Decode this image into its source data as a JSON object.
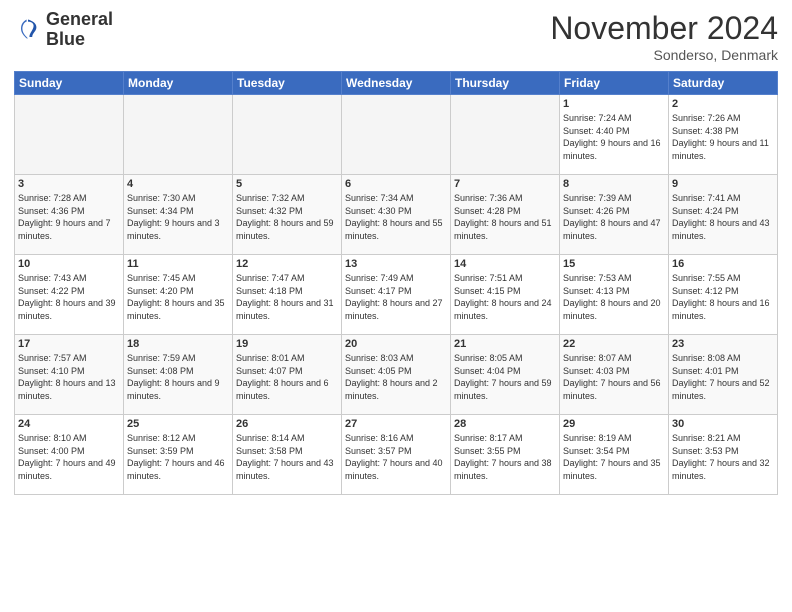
{
  "logo": {
    "line1": "General",
    "line2": "Blue"
  },
  "title": "November 2024",
  "location": "Sonderso, Denmark",
  "days_of_week": [
    "Sunday",
    "Monday",
    "Tuesday",
    "Wednesday",
    "Thursday",
    "Friday",
    "Saturday"
  ],
  "weeks": [
    [
      {
        "day": "",
        "info": ""
      },
      {
        "day": "",
        "info": ""
      },
      {
        "day": "",
        "info": ""
      },
      {
        "day": "",
        "info": ""
      },
      {
        "day": "",
        "info": ""
      },
      {
        "day": "1",
        "info": "Sunrise: 7:24 AM\nSunset: 4:40 PM\nDaylight: 9 hours and 16 minutes."
      },
      {
        "day": "2",
        "info": "Sunrise: 7:26 AM\nSunset: 4:38 PM\nDaylight: 9 hours and 11 minutes."
      }
    ],
    [
      {
        "day": "3",
        "info": "Sunrise: 7:28 AM\nSunset: 4:36 PM\nDaylight: 9 hours and 7 minutes."
      },
      {
        "day": "4",
        "info": "Sunrise: 7:30 AM\nSunset: 4:34 PM\nDaylight: 9 hours and 3 minutes."
      },
      {
        "day": "5",
        "info": "Sunrise: 7:32 AM\nSunset: 4:32 PM\nDaylight: 8 hours and 59 minutes."
      },
      {
        "day": "6",
        "info": "Sunrise: 7:34 AM\nSunset: 4:30 PM\nDaylight: 8 hours and 55 minutes."
      },
      {
        "day": "7",
        "info": "Sunrise: 7:36 AM\nSunset: 4:28 PM\nDaylight: 8 hours and 51 minutes."
      },
      {
        "day": "8",
        "info": "Sunrise: 7:39 AM\nSunset: 4:26 PM\nDaylight: 8 hours and 47 minutes."
      },
      {
        "day": "9",
        "info": "Sunrise: 7:41 AM\nSunset: 4:24 PM\nDaylight: 8 hours and 43 minutes."
      }
    ],
    [
      {
        "day": "10",
        "info": "Sunrise: 7:43 AM\nSunset: 4:22 PM\nDaylight: 8 hours and 39 minutes."
      },
      {
        "day": "11",
        "info": "Sunrise: 7:45 AM\nSunset: 4:20 PM\nDaylight: 8 hours and 35 minutes."
      },
      {
        "day": "12",
        "info": "Sunrise: 7:47 AM\nSunset: 4:18 PM\nDaylight: 8 hours and 31 minutes."
      },
      {
        "day": "13",
        "info": "Sunrise: 7:49 AM\nSunset: 4:17 PM\nDaylight: 8 hours and 27 minutes."
      },
      {
        "day": "14",
        "info": "Sunrise: 7:51 AM\nSunset: 4:15 PM\nDaylight: 8 hours and 24 minutes."
      },
      {
        "day": "15",
        "info": "Sunrise: 7:53 AM\nSunset: 4:13 PM\nDaylight: 8 hours and 20 minutes."
      },
      {
        "day": "16",
        "info": "Sunrise: 7:55 AM\nSunset: 4:12 PM\nDaylight: 8 hours and 16 minutes."
      }
    ],
    [
      {
        "day": "17",
        "info": "Sunrise: 7:57 AM\nSunset: 4:10 PM\nDaylight: 8 hours and 13 minutes."
      },
      {
        "day": "18",
        "info": "Sunrise: 7:59 AM\nSunset: 4:08 PM\nDaylight: 8 hours and 9 minutes."
      },
      {
        "day": "19",
        "info": "Sunrise: 8:01 AM\nSunset: 4:07 PM\nDaylight: 8 hours and 6 minutes."
      },
      {
        "day": "20",
        "info": "Sunrise: 8:03 AM\nSunset: 4:05 PM\nDaylight: 8 hours and 2 minutes."
      },
      {
        "day": "21",
        "info": "Sunrise: 8:05 AM\nSunset: 4:04 PM\nDaylight: 7 hours and 59 minutes."
      },
      {
        "day": "22",
        "info": "Sunrise: 8:07 AM\nSunset: 4:03 PM\nDaylight: 7 hours and 56 minutes."
      },
      {
        "day": "23",
        "info": "Sunrise: 8:08 AM\nSunset: 4:01 PM\nDaylight: 7 hours and 52 minutes."
      }
    ],
    [
      {
        "day": "24",
        "info": "Sunrise: 8:10 AM\nSunset: 4:00 PM\nDaylight: 7 hours and 49 minutes."
      },
      {
        "day": "25",
        "info": "Sunrise: 8:12 AM\nSunset: 3:59 PM\nDaylight: 7 hours and 46 minutes."
      },
      {
        "day": "26",
        "info": "Sunrise: 8:14 AM\nSunset: 3:58 PM\nDaylight: 7 hours and 43 minutes."
      },
      {
        "day": "27",
        "info": "Sunrise: 8:16 AM\nSunset: 3:57 PM\nDaylight: 7 hours and 40 minutes."
      },
      {
        "day": "28",
        "info": "Sunrise: 8:17 AM\nSunset: 3:55 PM\nDaylight: 7 hours and 38 minutes."
      },
      {
        "day": "29",
        "info": "Sunrise: 8:19 AM\nSunset: 3:54 PM\nDaylight: 7 hours and 35 minutes."
      },
      {
        "day": "30",
        "info": "Sunrise: 8:21 AM\nSunset: 3:53 PM\nDaylight: 7 hours and 32 minutes."
      }
    ]
  ]
}
